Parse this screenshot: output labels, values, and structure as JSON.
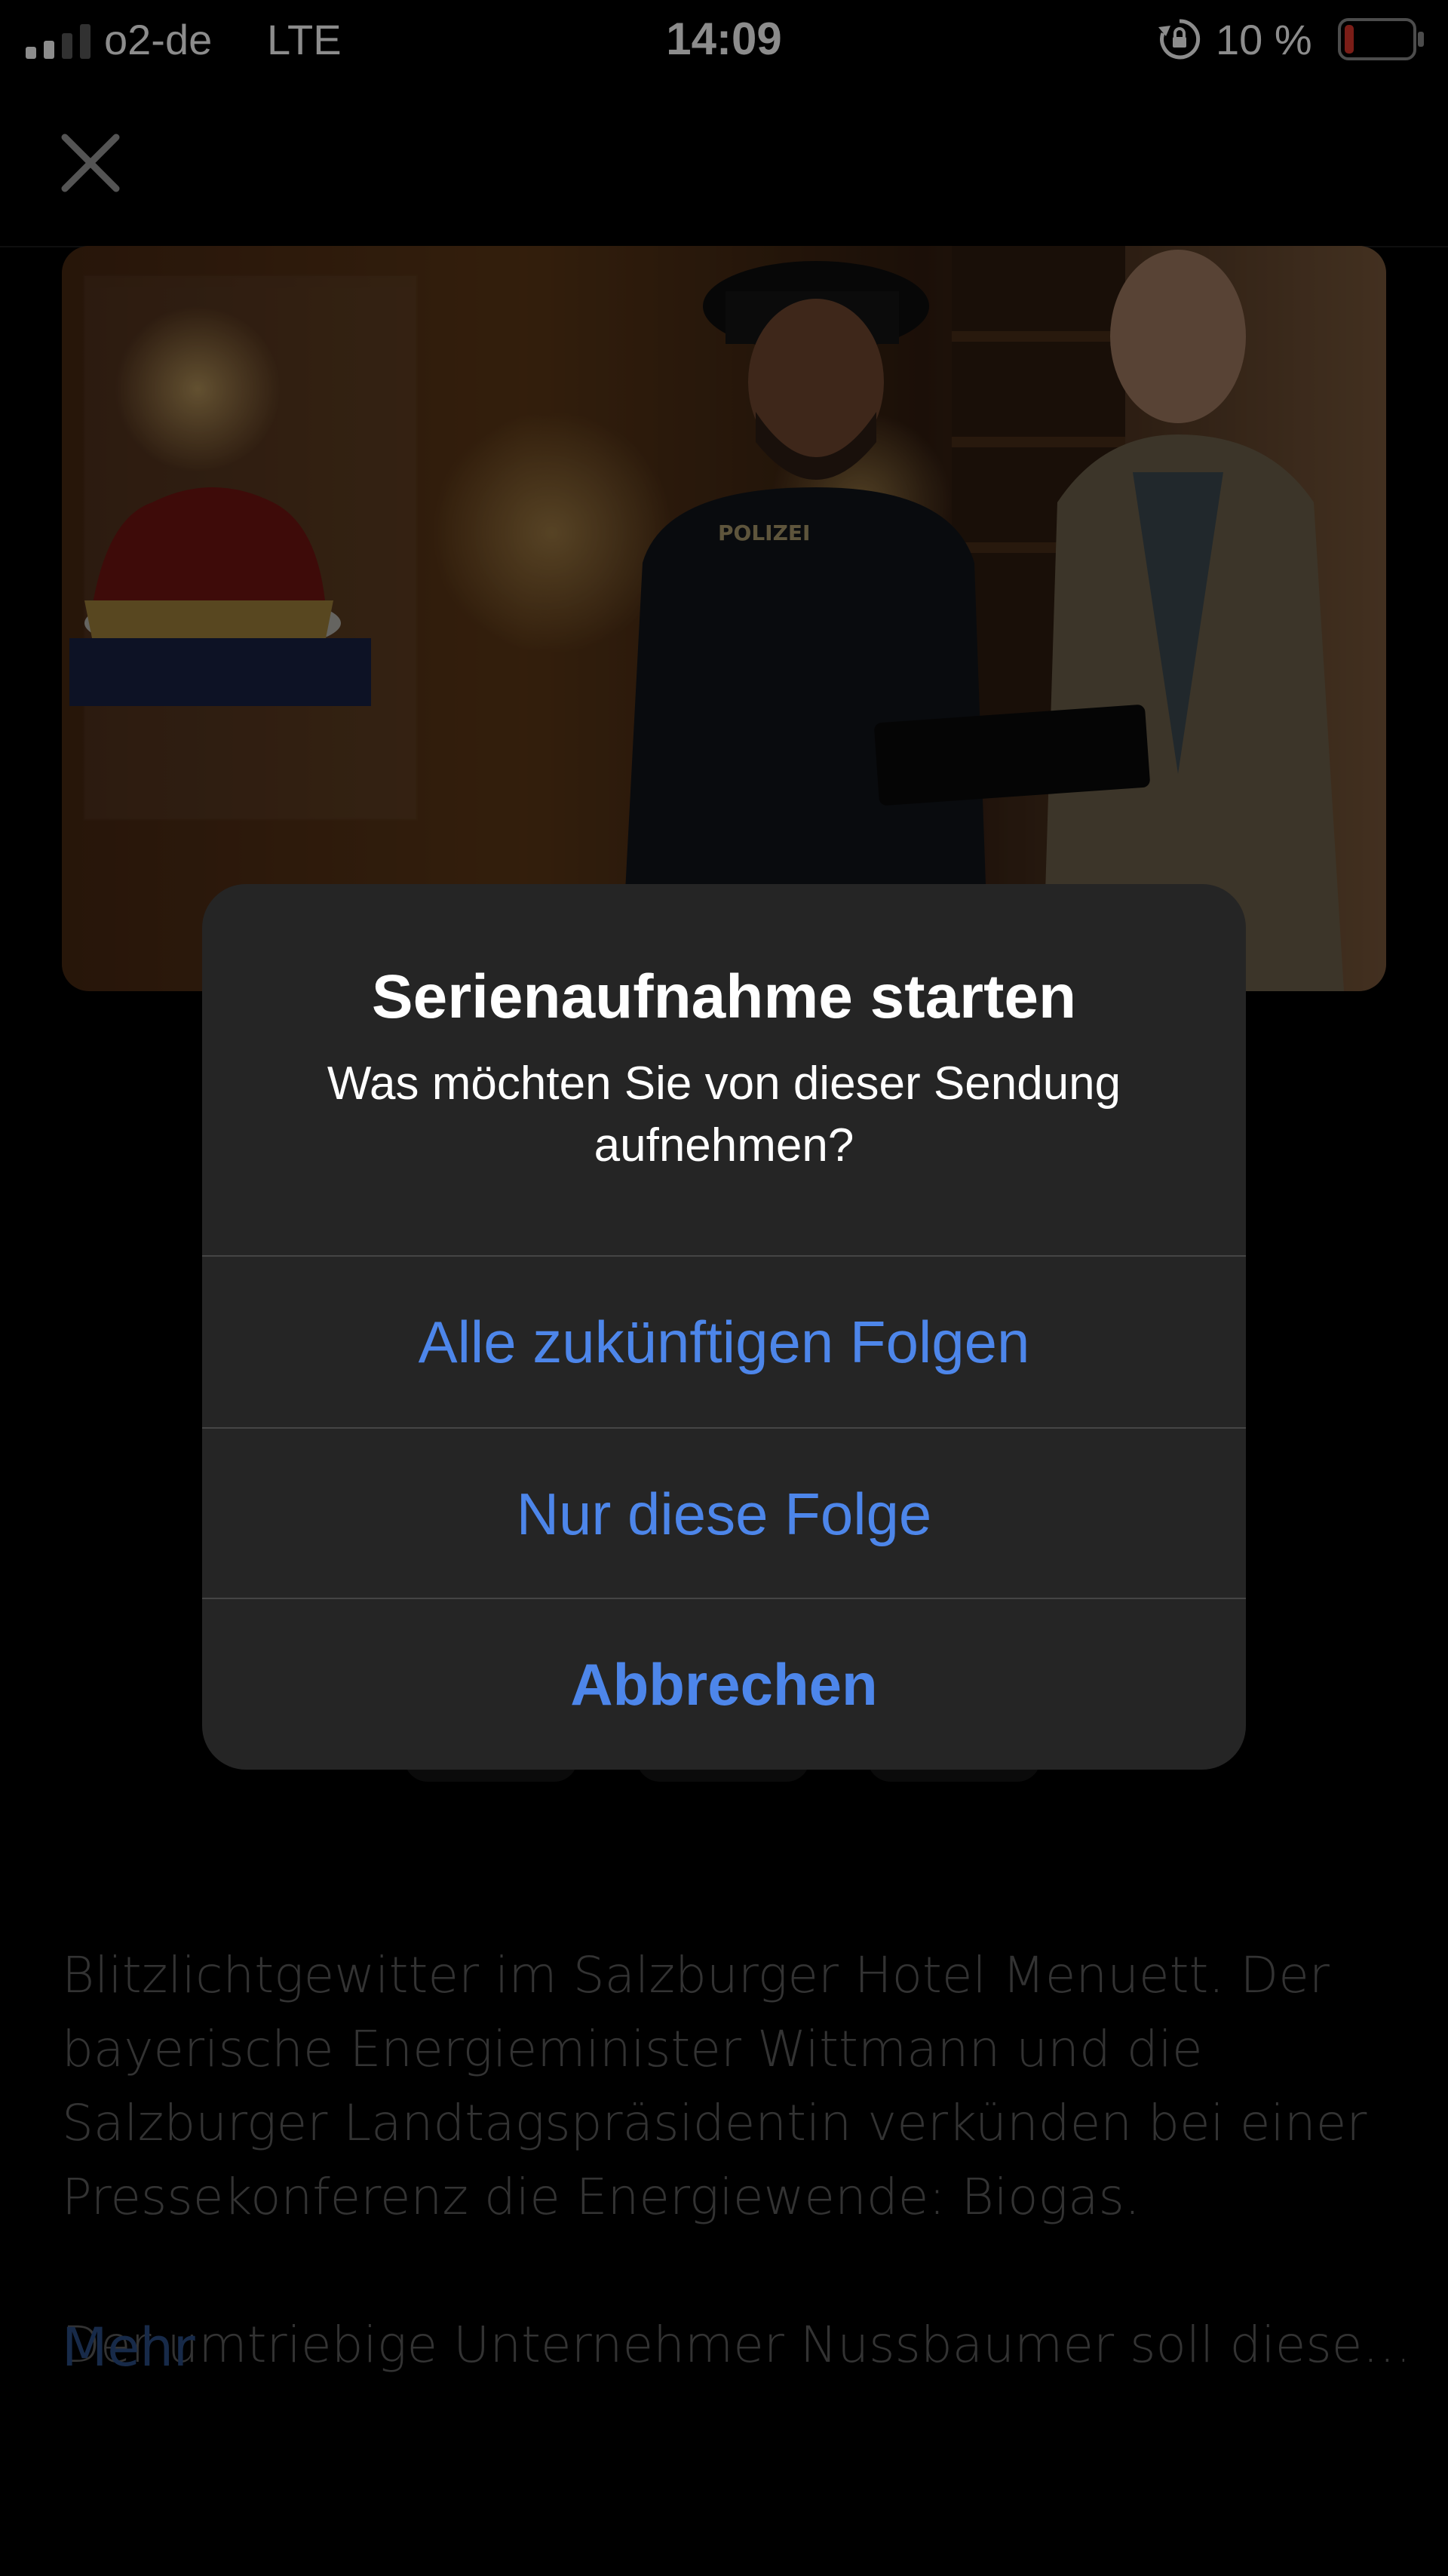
{
  "status_bar": {
    "carrier": "o2-de",
    "network": "LTE",
    "time": "14:09",
    "battery_percent": "10 %",
    "signal_bars": 2,
    "battery_level": 0.1,
    "battery_color": "#e0352b"
  },
  "nav": {
    "close_icon": "close-icon"
  },
  "description": {
    "text": "Blitzlichtgewitter im Salzburger Hotel Menuett. Der bayerische Energieminister Wittmann und die Salzburger Landtagspräsidentin verkünden bei einer Pressekonferenz die Energiewende: Biogas.",
    "text_last": "Der umtriebige Unternehmer Nussbaumer soll diese…",
    "more_label": "Mehr"
  },
  "alert": {
    "title": "Serienaufnahme starten",
    "message": "Was möchten Sie von dieser Sendung aufnehmen?",
    "buttons": {
      "all_episodes": "Alle zukünftigen Folgen",
      "this_episode": "Nur diese Folge",
      "cancel": "Abbrechen"
    }
  },
  "colors": {
    "accent": "#4d86ea",
    "link_dimmed": "#2b4e86",
    "alert_bg": "#252525"
  }
}
